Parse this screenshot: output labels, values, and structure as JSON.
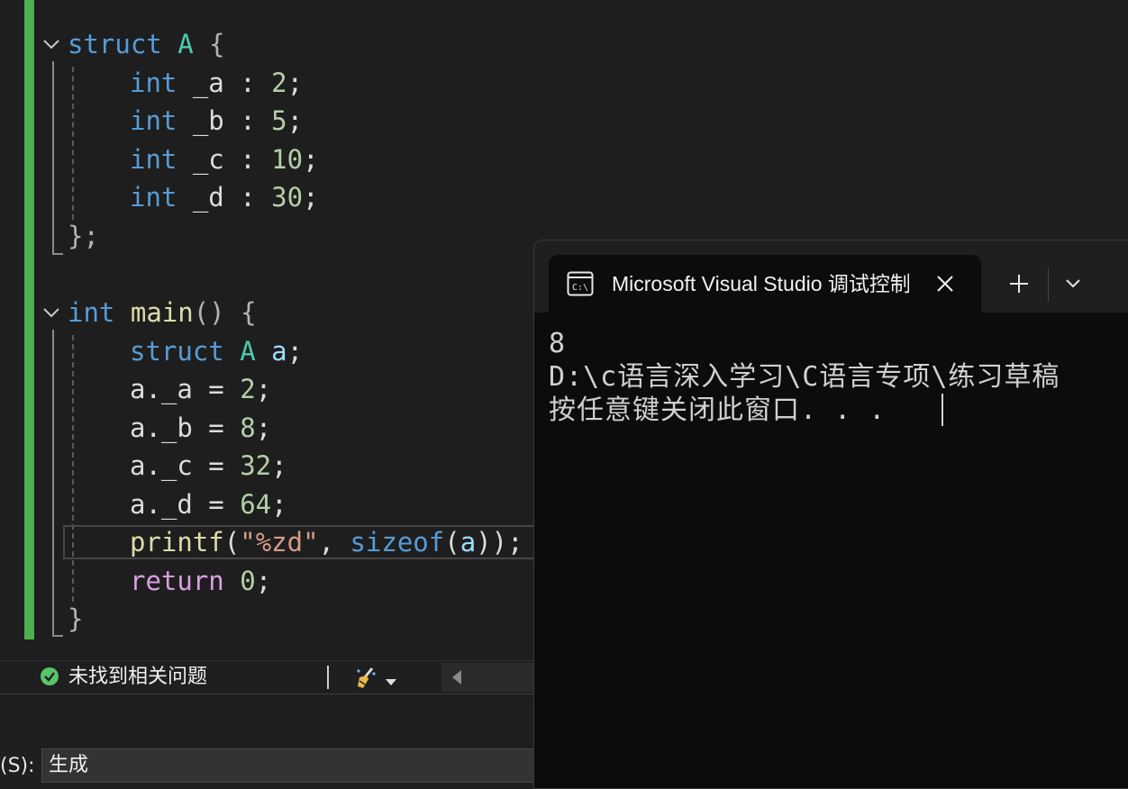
{
  "editor": {
    "lines": [
      {
        "tokens": [
          {
            "t": "struct",
            "c": "kw"
          },
          {
            "t": " ",
            "c": "pl"
          },
          {
            "t": "A",
            "c": "ty"
          },
          {
            "t": " {",
            "c": "brace"
          }
        ]
      },
      {
        "tokens": [
          {
            "t": "int",
            "c": "kw"
          },
          {
            "t": " _a : ",
            "c": "pl"
          },
          {
            "t": "2",
            "c": "num"
          },
          {
            "t": ";",
            "c": "pl"
          }
        ]
      },
      {
        "tokens": [
          {
            "t": "int",
            "c": "kw"
          },
          {
            "t": " _b : ",
            "c": "pl"
          },
          {
            "t": "5",
            "c": "num"
          },
          {
            "t": ";",
            "c": "pl"
          }
        ]
      },
      {
        "tokens": [
          {
            "t": "int",
            "c": "kw"
          },
          {
            "t": " _c : ",
            "c": "pl"
          },
          {
            "t": "10",
            "c": "num"
          },
          {
            "t": ";",
            "c": "pl"
          }
        ]
      },
      {
        "tokens": [
          {
            "t": "int",
            "c": "kw"
          },
          {
            "t": " _d : ",
            "c": "pl"
          },
          {
            "t": "30",
            "c": "num"
          },
          {
            "t": ";",
            "c": "pl"
          }
        ]
      },
      {
        "tokens": [
          {
            "t": "};",
            "c": "brace"
          }
        ]
      },
      {
        "tokens": []
      },
      {
        "tokens": [
          {
            "t": "int",
            "c": "kw"
          },
          {
            "t": " ",
            "c": "pl"
          },
          {
            "t": "main",
            "c": "fn"
          },
          {
            "t": "() {",
            "c": "brace"
          }
        ]
      },
      {
        "tokens": [
          {
            "t": "struct",
            "c": "kw"
          },
          {
            "t": " ",
            "c": "pl"
          },
          {
            "t": "A",
            "c": "ty"
          },
          {
            "t": " ",
            "c": "pl"
          },
          {
            "t": "a",
            "c": "var"
          },
          {
            "t": ";",
            "c": "pl"
          }
        ]
      },
      {
        "tokens": [
          {
            "t": "a._a = ",
            "c": "pl"
          },
          {
            "t": "2",
            "c": "num"
          },
          {
            "t": ";",
            "c": "pl"
          }
        ]
      },
      {
        "tokens": [
          {
            "t": "a._b = ",
            "c": "pl"
          },
          {
            "t": "8",
            "c": "num"
          },
          {
            "t": ";",
            "c": "pl"
          }
        ]
      },
      {
        "tokens": [
          {
            "t": "a._c = ",
            "c": "pl"
          },
          {
            "t": "32",
            "c": "num"
          },
          {
            "t": ";",
            "c": "pl"
          }
        ]
      },
      {
        "tokens": [
          {
            "t": "a._d = ",
            "c": "pl"
          },
          {
            "t": "64",
            "c": "num"
          },
          {
            "t": ";",
            "c": "pl"
          }
        ]
      },
      {
        "tokens": [
          {
            "t": "printf",
            "c": "fn"
          },
          {
            "t": "(",
            "c": "pl"
          },
          {
            "t": "\"%zd\"",
            "c": "str"
          },
          {
            "t": ", ",
            "c": "pl"
          },
          {
            "t": "sizeof",
            "c": "kw"
          },
          {
            "t": "(",
            "c": "pl"
          },
          {
            "t": "a",
            "c": "var"
          },
          {
            "t": "));",
            "c": "pl"
          }
        ]
      },
      {
        "tokens": [
          {
            "t": "return",
            "c": "ret"
          },
          {
            "t": " ",
            "c": "pl"
          },
          {
            "t": "0",
            "c": "num"
          },
          {
            "t": ";",
            "c": "pl"
          }
        ]
      },
      {
        "tokens": [
          {
            "t": "}",
            "c": "brace"
          }
        ]
      }
    ]
  },
  "status": {
    "issues_text": "未找到相关问题"
  },
  "output": {
    "label": "(S):",
    "source_value": "生成"
  },
  "console": {
    "tab_title": "Microsoft Visual Studio 调试控制台",
    "lines": [
      "8",
      "D:\\c语言深入学习\\C语言专项\\练习草稿",
      "按任意键关闭此窗口. . ."
    ]
  },
  "colors": {
    "keyword": "#569cd6",
    "type": "#4ec9b0",
    "number": "#b5cea8",
    "function": "#dcdcaa",
    "string": "#d69d85",
    "control": "#d8a0df",
    "change_bar": "#4caf50",
    "ok_green": "#5ac46a"
  }
}
